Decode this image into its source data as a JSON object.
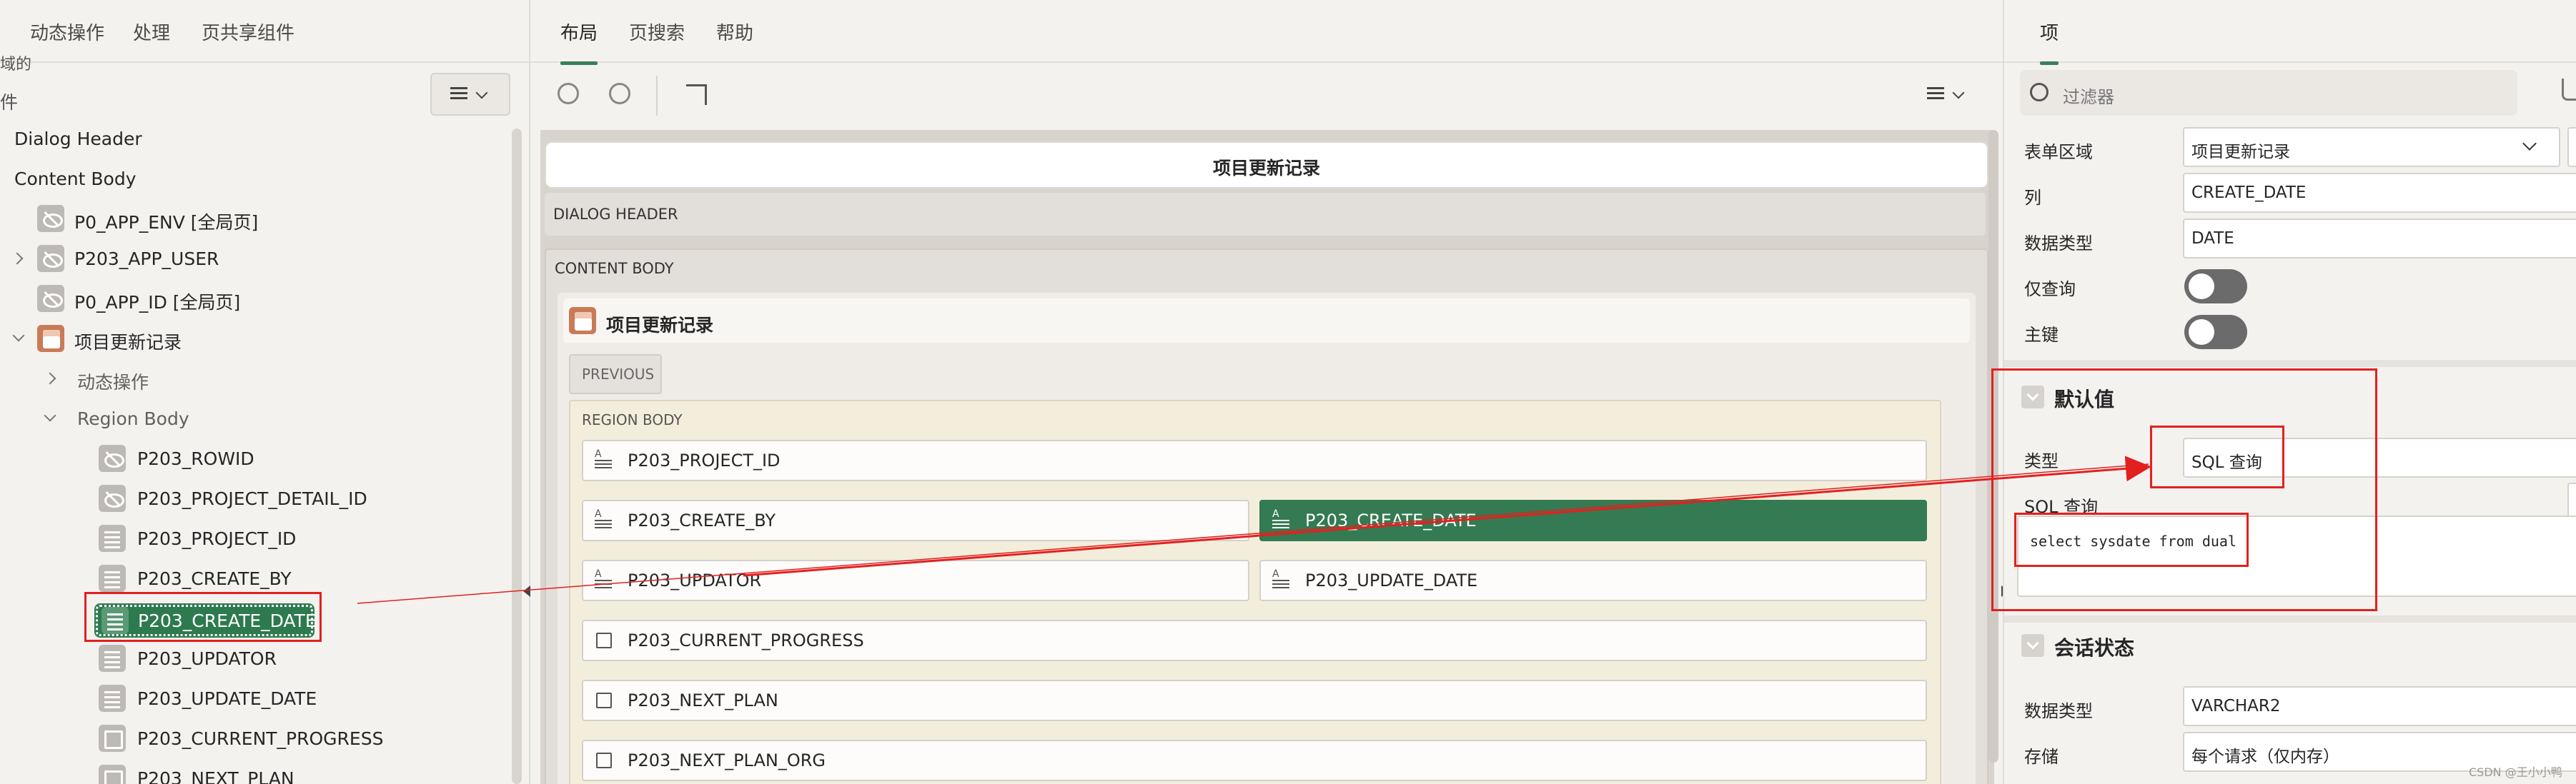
{
  "left": {
    "tabs": [
      "动态操作",
      "处理",
      "页共享组件"
    ],
    "cut_top_text": "域的",
    "cut_side_text": "件",
    "tree": [
      {
        "label": "Dialog Header"
      },
      {
        "label": "Content Body"
      },
      {
        "label": "P0_APP_ENV [全局页]"
      },
      {
        "label": "P203_APP_USER"
      },
      {
        "label": "P0_APP_ID [全局页]"
      },
      {
        "label": "项目更新记录"
      },
      {
        "label": "动态操作"
      },
      {
        "label": "Region Body"
      },
      {
        "label": "P203_ROWID"
      },
      {
        "label": "P203_PROJECT_DETAIL_ID"
      },
      {
        "label": "P203_PROJECT_ID"
      },
      {
        "label": "P203_CREATE_BY"
      },
      {
        "label": "P203_CREATE_DATE"
      },
      {
        "label": "P203_UPDATOR"
      },
      {
        "label": "P203_UPDATE_DATE"
      },
      {
        "label": "P203_CURRENT_PROGRESS"
      },
      {
        "label": "P203_NEXT_PLAN"
      }
    ]
  },
  "middle": {
    "tabs": [
      "布局",
      "页搜索",
      "帮助"
    ],
    "page_title": "项目更新记录",
    "dialog_header": "DIALOG HEADER",
    "content_body": "CONTENT BODY",
    "region_title": "项目更新记录",
    "previous_button": "PREVIOUS",
    "region_body": "REGION BODY",
    "fields": [
      "P203_PROJECT_ID",
      "P203_CREATE_BY",
      "P203_CREATE_DATE",
      "P203_UPDATOR",
      "P203_UPDATE_DATE",
      "P203_CURRENT_PROGRESS",
      "P203_NEXT_PLAN",
      "P203_NEXT_PLAN_ORG"
    ]
  },
  "right": {
    "tab": "项",
    "filter_placeholder": "过滤器",
    "props": [
      {
        "label": "表单区域",
        "value": "项目更新记录"
      },
      {
        "label": "列",
        "value": "CREATE_DATE"
      },
      {
        "label": "数据类型",
        "value": "DATE"
      },
      {
        "label": "仅查询",
        "value": ""
      },
      {
        "label": "主键",
        "value": ""
      }
    ],
    "default_section": "默认值",
    "default_type_label": "类型",
    "default_type_value": "SQL 查询",
    "sql_query_label": "SQL 查询",
    "sql_query_value": "select sysdate from dual",
    "session_section": "会话状态",
    "session_props": [
      {
        "label": "数据类型",
        "value": "VARCHAR2"
      },
      {
        "label": "存储",
        "value": "每个请求（仅内存）"
      }
    ],
    "watermark": "CSDN @王小小鸭"
  },
  "colors": {
    "accent_green": "#3b7f5a",
    "selected_green": "#2d7a4f",
    "annotation_red": "#e32020"
  }
}
